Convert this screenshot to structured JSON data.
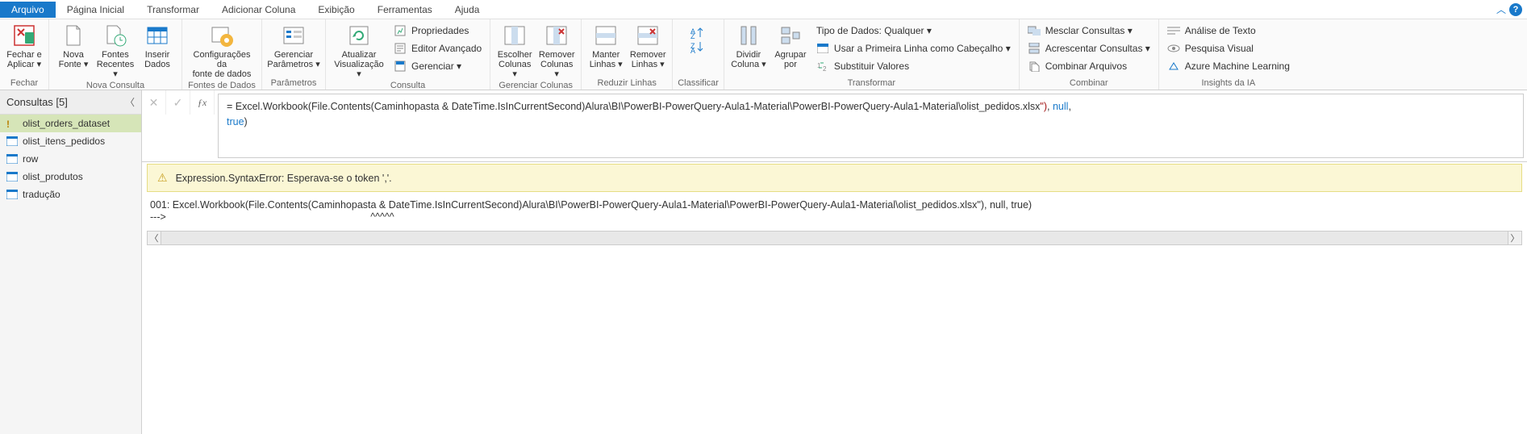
{
  "tabs": {
    "items": [
      "Arquivo",
      "Página Inicial",
      "Transformar",
      "Adicionar Coluna",
      "Exibição",
      "Ferramentas",
      "Ajuda"
    ],
    "active_index": 0
  },
  "ribbon": {
    "groups": [
      {
        "label": "Fechar",
        "big": [
          {
            "name": "close-apply",
            "label": "Fechar e\nAplicar ▾",
            "icon": "close-apply"
          }
        ]
      },
      {
        "label": "Nova Consulta",
        "big": [
          {
            "name": "new-source",
            "label": "Nova\nFonte ▾",
            "icon": "doc"
          },
          {
            "name": "recent-sources",
            "label": "Fontes\nRecentes ▾",
            "icon": "doc-clock"
          },
          {
            "name": "enter-data",
            "label": "Inserir\nDados",
            "icon": "table"
          }
        ]
      },
      {
        "label": "Fontes de Dados",
        "big": [
          {
            "name": "data-source-settings",
            "label": "Configurações da\nfonte de dados",
            "icon": "gear"
          }
        ]
      },
      {
        "label": "Parâmetros",
        "big": [
          {
            "name": "manage-params",
            "label": "Gerenciar\nParâmetros ▾",
            "icon": "params"
          }
        ]
      },
      {
        "label": "Consulta",
        "big": [
          {
            "name": "refresh-preview",
            "label": "Atualizar\nVisualização ▾",
            "icon": "refresh"
          }
        ],
        "small": [
          {
            "name": "properties",
            "label": "Propriedades",
            "icon": "props"
          },
          {
            "name": "advanced-editor",
            "label": "Editor Avançado",
            "icon": "adv"
          },
          {
            "name": "manage-menu",
            "label": "Gerenciar ▾",
            "icon": "manage"
          }
        ]
      },
      {
        "label": "Gerenciar Colunas",
        "big": [
          {
            "name": "choose-columns",
            "label": "Escolher\nColunas ▾",
            "icon": "choose-cols"
          },
          {
            "name": "remove-columns",
            "label": "Remover\nColunas ▾",
            "icon": "remove-cols"
          }
        ]
      },
      {
        "label": "Reduzir Linhas",
        "big": [
          {
            "name": "keep-rows",
            "label": "Manter\nLinhas ▾",
            "icon": "keep-rows"
          },
          {
            "name": "remove-rows",
            "label": "Remover\nLinhas ▾",
            "icon": "remove-rows"
          }
        ]
      },
      {
        "label": "Classificar",
        "big": [
          {
            "name": "sort",
            "label": "",
            "icon": "sort"
          }
        ]
      },
      {
        "label": "Transformar",
        "big": [
          {
            "name": "split-column",
            "label": "Dividir\nColuna ▾",
            "icon": "split"
          },
          {
            "name": "group-by",
            "label": "Agrupar\npor",
            "icon": "group"
          }
        ],
        "small": [
          {
            "name": "data-type",
            "label": "Tipo de Dados: Qualquer ▾",
            "icon": ""
          },
          {
            "name": "first-row-headers",
            "label": "Usar a Primeira Linha como Cabeçalho ▾",
            "icon": "headers"
          },
          {
            "name": "replace-values",
            "label": "Substituir Valores",
            "icon": "replace"
          }
        ]
      },
      {
        "label": "Combinar",
        "small": [
          {
            "name": "merge-queries",
            "label": "Mesclar Consultas ▾",
            "icon": "merge"
          },
          {
            "name": "append-queries",
            "label": "Acrescentar Consultas ▾",
            "icon": "append"
          },
          {
            "name": "combine-files",
            "label": "Combinar Arquivos",
            "icon": "combine"
          }
        ]
      },
      {
        "label": "Insights da IA",
        "small": [
          {
            "name": "text-analytics",
            "label": "Análise de Texto",
            "icon": "text-an"
          },
          {
            "name": "vision",
            "label": "Pesquisa Visual",
            "icon": "vision"
          },
          {
            "name": "azure-ml",
            "label": "Azure Machine Learning",
            "icon": "azure"
          }
        ]
      }
    ]
  },
  "queries": {
    "title": "Consultas [5]",
    "items": [
      {
        "name": "olist_orders_dataset",
        "warn": true,
        "active": true
      },
      {
        "name": "olist_itens_pedidos",
        "warn": false,
        "active": false
      },
      {
        "name": "row",
        "warn": false,
        "active": false
      },
      {
        "name": "olist_produtos",
        "warn": false,
        "active": false
      },
      {
        "name": "tradução",
        "warn": false,
        "active": false
      }
    ]
  },
  "formula": {
    "prefix": "= Excel.Workbook(File.Contents(Caminhopasta & DateTime.IsInCurrentSecond)Alura\\BI\\PowerBI-PowerQuery-Aula1-Material\\PowerBI-PowerQuery-Aula1-Material\\olist_pedidos.xlsx",
    "str_tail": "\")",
    "null_kw": "null",
    "true_kw": "true",
    "close": ")"
  },
  "error": {
    "message": "Expression.SyntaxError: Esperava-se o token ','."
  },
  "code": {
    "line1": "001: Excel.Workbook(File.Contents(Caminhopasta & DateTime.IsInCurrentSecond)Alura\\BI\\PowerBI-PowerQuery-Aula1-Material\\PowerBI-PowerQuery-Aula1-Material\\olist_pedidos.xlsx\"), null, true)",
    "line2": "--->                                                                         ^^^^^"
  }
}
